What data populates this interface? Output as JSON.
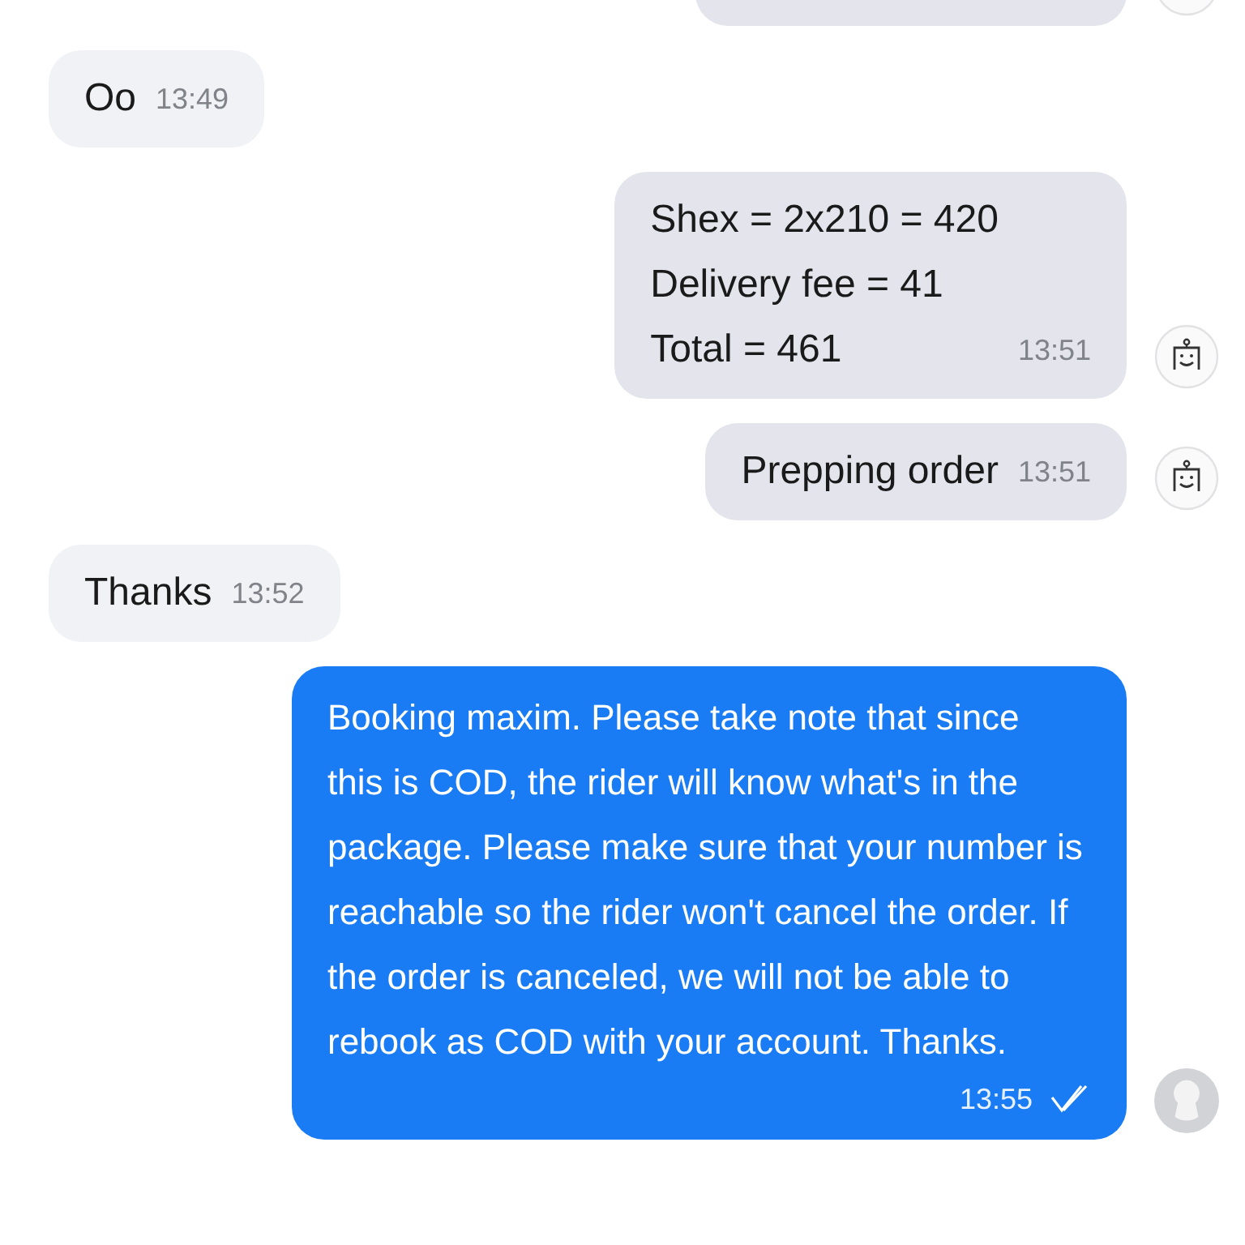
{
  "messages": [
    {
      "outgoing": true,
      "kind": "partial",
      "bot_reply": true
    },
    {
      "outgoing": false,
      "kind": "plain",
      "lines": [
        "Oo"
      ],
      "time": "13:49"
    },
    {
      "outgoing": true,
      "kind": "plain",
      "lines": [
        "Shex = 2x210 = 420",
        "Delivery fee = 41",
        "Total = 461"
      ],
      "time": "13:51",
      "bot_reply": true
    },
    {
      "outgoing": true,
      "kind": "plain",
      "lines": [
        "Prepping order"
      ],
      "time": "13:51",
      "bot_reply": true
    },
    {
      "outgoing": false,
      "kind": "plain",
      "lines": [
        "Thanks"
      ],
      "time": "13:52"
    },
    {
      "outgoing": true,
      "kind": "accent",
      "lines": [
        "Booking maxim. Please take note that since this is COD, the rider will know what's in the package. Please make sure that your number is reachable so the rider won't cancel the order. If the order is canceled, we will not be able to rebook as COD with your account. Thanks."
      ],
      "time": "13:55",
      "read": true,
      "bot_reply": false
    }
  ]
}
